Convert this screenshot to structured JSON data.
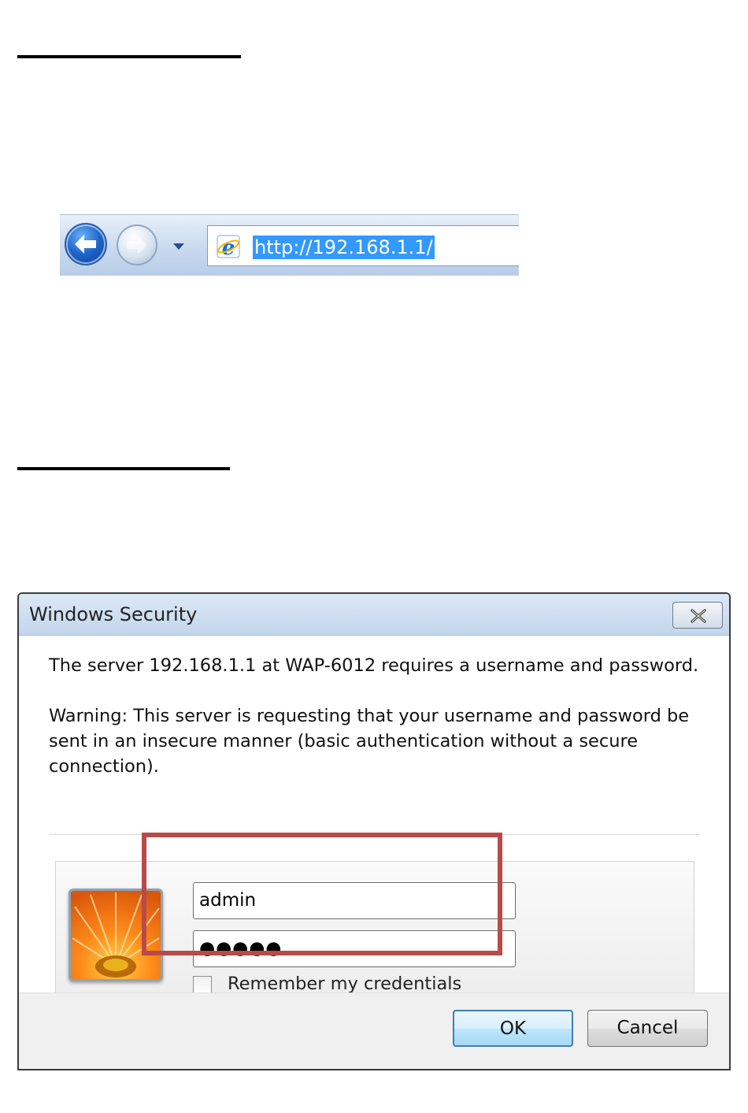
{
  "browser": {
    "address": "http://192.168.1.1/",
    "icons": [
      "back-arrow-icon",
      "forward-arrow-icon",
      "history-dropdown-icon",
      "internet-explorer-icon"
    ]
  },
  "dialog": {
    "title": "Windows Security",
    "message": "The server 192.168.1.1 at WAP-6012 requires a username and password.",
    "warning": "Warning: This server is requesting that your username and password be sent in an insecure manner (basic authentication without a secure connection).",
    "username_value": "admin",
    "password_value": "●●●●●",
    "remember_label": "Remember my credentials",
    "remember_checked": false,
    "ok_label": "OK",
    "cancel_label": "Cancel",
    "highlight_color": "#b94a4a"
  }
}
